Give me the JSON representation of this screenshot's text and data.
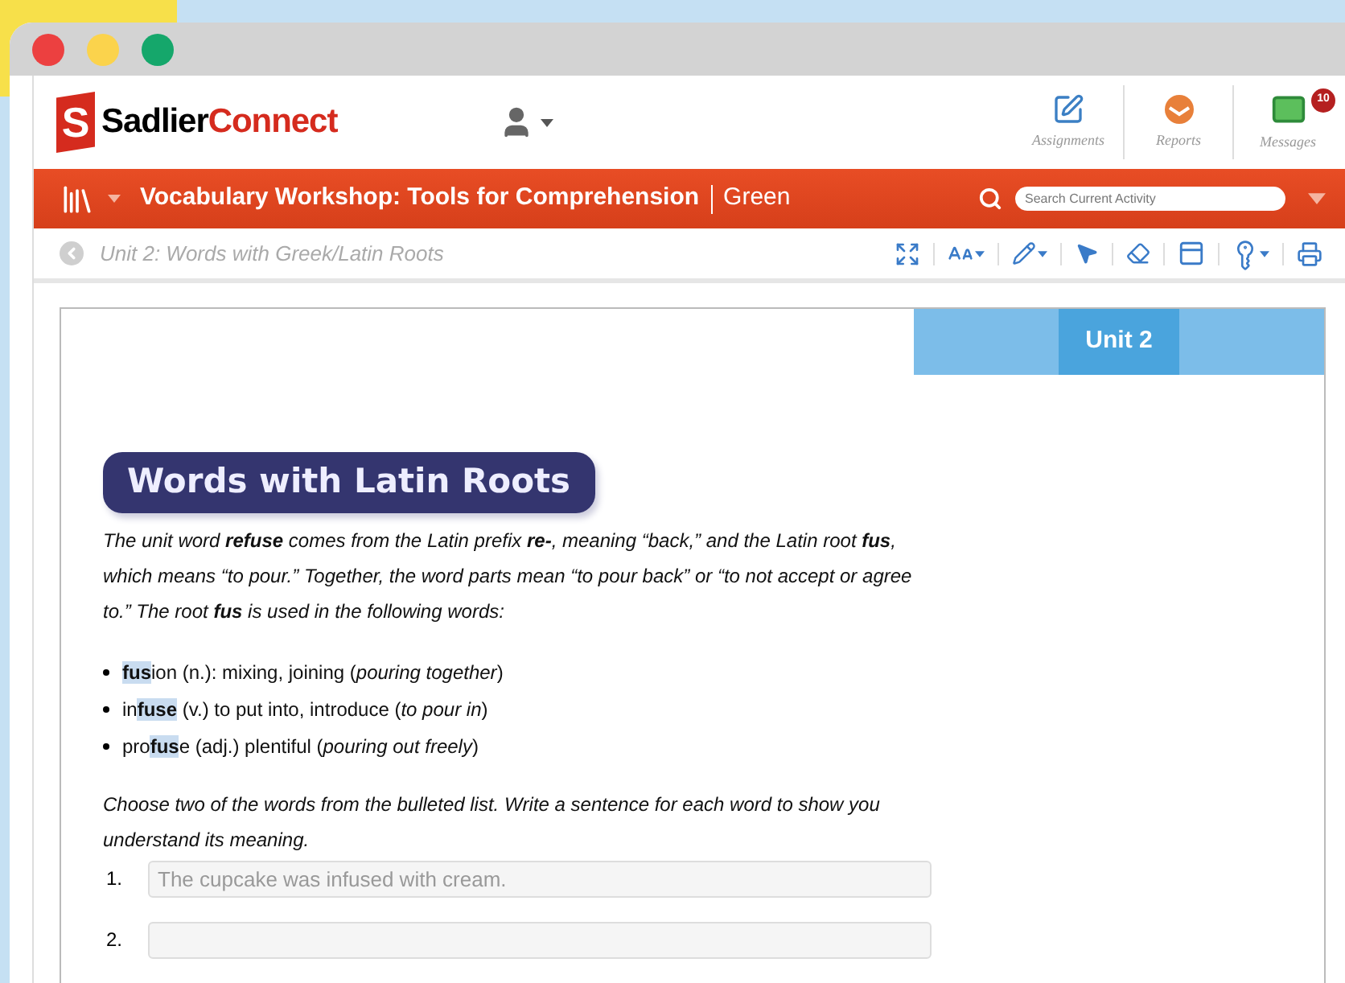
{
  "logo": {
    "mark": "S",
    "name_first": "Sadlier",
    "name_second": "Connect"
  },
  "nav": [
    {
      "kind": "assignments",
      "label": "Assignments"
    },
    {
      "kind": "reports",
      "label": "Reports"
    },
    {
      "kind": "messages",
      "label": "Messages",
      "badge": "10"
    }
  ],
  "course_bar": {
    "title": "Vocabulary Workshop: Tools for Comprehension",
    "level": "Green",
    "search": {
      "placeholder": "Search Current Activity"
    }
  },
  "breadcrumb": "Unit 2: Words with Greek/Latin Roots",
  "tools": [
    {
      "kind": "expand",
      "menu": false
    },
    {
      "kind": "text-size",
      "menu": true
    },
    {
      "kind": "pen",
      "menu": true
    },
    {
      "kind": "pointer",
      "menu": false
    },
    {
      "kind": "eraser",
      "menu": false
    },
    {
      "kind": "mask",
      "menu": false
    },
    {
      "kind": "key",
      "menu": true
    },
    {
      "kind": "print",
      "menu": false
    }
  ],
  "unit_banner": "Unit 2",
  "heading": "Words with Latin Roots",
  "intro": "The unit word **refuse** comes from the Latin prefix **re-**, meaning “back,” and the Latin root **fus**, which means “to pour.” Together, the word parts mean “to pour back” or “to not accept or agree to.” The root **fus** is used in the following words:",
  "words": [
    {
      "root": "fus",
      "after": "ion",
      "highlighted": true,
      "definition": "(n.): mixing, joining (*pouring together*)"
    },
    {
      "before": "in",
      "root": "fuse",
      "highlighted": true,
      "definition": "(v.) to put into, introduce (*to pour in*)"
    },
    {
      "before": "pro",
      "root": "fus",
      "after": "e",
      "highlighted": true,
      "definition": "(adj.) plentiful (*pouring out freely*)"
    }
  ],
  "prompt": "Choose two of the words from the bulleted list. Write a sentence for each word to show you understand its meaning.",
  "answers": [
    {
      "number": "1.",
      "value": "The cupcake was infused with cream."
    },
    {
      "number": "2."
    }
  ]
}
